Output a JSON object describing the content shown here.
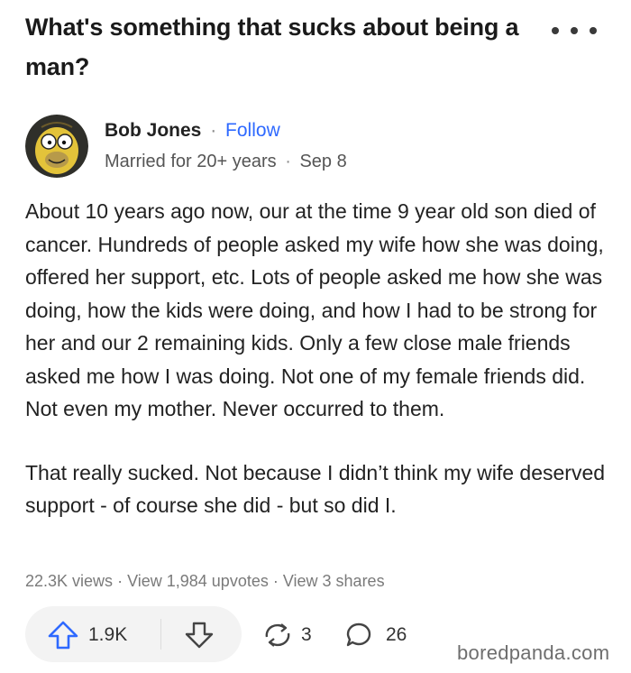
{
  "question": {
    "title": "What's something that sucks about being a man?"
  },
  "author": {
    "name": "Bob Jones",
    "follow_label": "Follow",
    "credential": "Married for 20+ years",
    "date": "Sep 8",
    "separator": "·",
    "avatar_icon": "cartoon-avatar"
  },
  "answer": {
    "paragraphs": [
      "About 10 years ago now, our at the time 9 year old son died of cancer. Hundreds of people asked my wife how she was doing, offered her support, etc. Lots of people asked me how she was doing, how the kids were doing, and how I had to be strong for her and our 2 remaining kids. Only a few close male friends asked me how I was doing. Not one of my female friends did. Not even my mother. Never occurred to them.",
      "That really sucked. Not because I didn’t think my wife deserved support - of course she did - but so did I."
    ]
  },
  "stats": {
    "views": "22.3K views",
    "upvotes": "View 1,984 upvotes",
    "shares": "View 3 shares"
  },
  "actions": {
    "upvote_count": "1.9K",
    "share_count": "3",
    "comment_count": "26"
  },
  "watermark": "boredpanda.com",
  "colors": {
    "accent": "#2e69ff",
    "text": "#222222",
    "muted": "#7a7a7a",
    "pill": "#f3f3f3"
  }
}
